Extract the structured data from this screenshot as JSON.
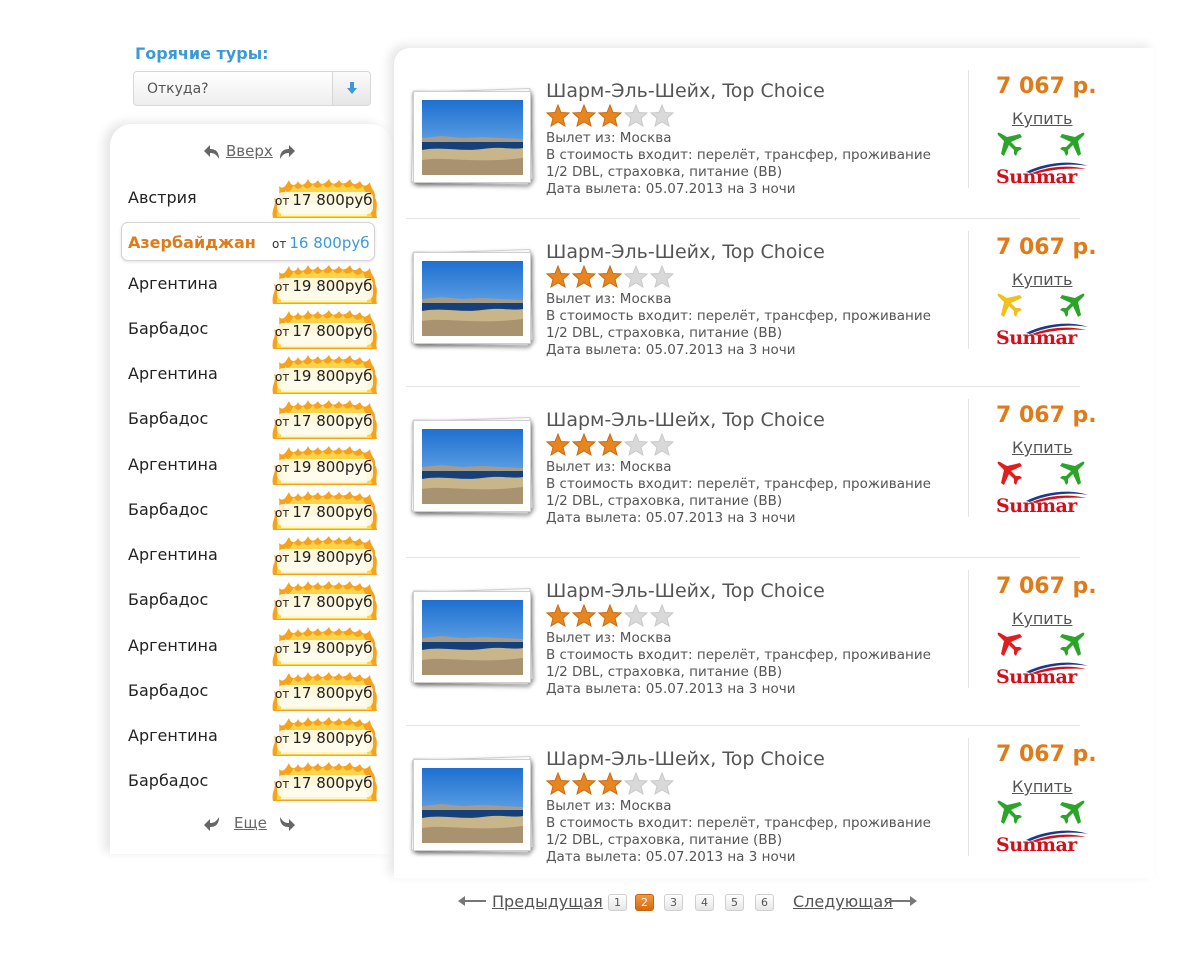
{
  "sidebar": {
    "title": "Горячие туры:",
    "from_placeholder": "Откуда?",
    "up_label": "Вверх",
    "more_label": "Еще",
    "price_prefix": "от",
    "selected": {
      "name": "Азербайджан",
      "price": "16 800руб"
    },
    "countries": [
      {
        "name": "Австрия",
        "price": "17 800руб"
      },
      {
        "name": "Аргентина",
        "price": "19 800руб"
      },
      {
        "name": "Барбадос",
        "price": "17 800руб"
      },
      {
        "name": "Аргентина",
        "price": "19 800руб"
      },
      {
        "name": "Барбадос",
        "price": "17 800руб"
      },
      {
        "name": "Аргентина",
        "price": "19 800руб"
      },
      {
        "name": "Барбадос",
        "price": "17 800руб"
      },
      {
        "name": "Аргентина",
        "price": "19 800руб"
      },
      {
        "name": "Барбадос",
        "price": "17 800руб"
      },
      {
        "name": "Аргентина",
        "price": "19 800руб"
      },
      {
        "name": "Барбадос",
        "price": "17 800руб"
      },
      {
        "name": "Аргентина",
        "price": "19 800руб"
      },
      {
        "name": "Барбадос",
        "price": "17 800руб"
      }
    ]
  },
  "tours": [
    {
      "title": "Шарм-Эль-Шейх, Top Choice",
      "stars": 3,
      "max_stars": 5,
      "departure": "Вылет из: Москва",
      "includes": "В стоимость входит: перелёт, трансфер, проживание  1/2 DBL, страховка, питание (BB)",
      "date": "Дата вылета: 05.07.2013 на 3 ночи",
      "price": "7 067 р.",
      "buy": "Купить",
      "plane_out_color": "#2aa52a",
      "plane_back_color": "#2aa52a",
      "operator": "Sunmar"
    },
    {
      "title": "Шарм-Эль-Шейх, Top Choice",
      "stars": 3,
      "max_stars": 5,
      "departure": "Вылет из: Москва",
      "includes": "В стоимость входит: перелёт, трансфер, проживание  1/2 DBL, страховка, питание (BB)",
      "date": "Дата вылета: 05.07.2013 на 3 ночи",
      "price": "7 067 р.",
      "buy": "Купить",
      "plane_out_color": "#f2c01a",
      "plane_back_color": "#2aa52a",
      "operator": "Sunmar"
    },
    {
      "title": "Шарм-Эль-Шейх, Top Choice",
      "stars": 3,
      "max_stars": 5,
      "departure": "Вылет из: Москва",
      "includes": "В стоимость входит: перелёт, трансфер, проживание  1/2 DBL, страховка, питание (BB)",
      "date": "Дата вылета: 05.07.2013 на 3 ночи",
      "price": "7 067 р.",
      "buy": "Купить",
      "plane_out_color": "#e21d1d",
      "plane_back_color": "#2aa52a",
      "operator": "Sunmar"
    },
    {
      "title": "Шарм-Эль-Шейх, Top Choice",
      "stars": 3,
      "max_stars": 5,
      "departure": "Вылет из: Москва",
      "includes": "В стоимость входит: перелёт, трансфер, проживание  1/2 DBL, страховка, питание (BB)",
      "date": "Дата вылета: 05.07.2013 на 3 ночи",
      "price": "7 067 р.",
      "buy": "Купить",
      "plane_out_color": "#e21d1d",
      "plane_back_color": "#2aa52a",
      "operator": "Sunmar"
    },
    {
      "title": "Шарм-Эль-Шейх, Top Choice",
      "stars": 3,
      "max_stars": 5,
      "departure": "Вылет из: Москва",
      "includes": "В стоимость входит: перелёт, трансфер, проживание  1/2 DBL, страховка, питание (BB)",
      "date": "Дата вылета: 05.07.2013 на 3 ночи",
      "price": "7 067 р.",
      "buy": "Купить",
      "plane_out_color": "#2aa52a",
      "plane_back_color": "#2aa52a",
      "operator": "Sunmar"
    }
  ],
  "pagination": {
    "prev_label": "Предыдущая",
    "next_label": "Следующая",
    "pages": [
      "1",
      "2",
      "3",
      "4",
      "5",
      "6"
    ],
    "current": "2"
  },
  "colors": {
    "accent_blue": "#3a9ad9",
    "accent_orange": "#e07b1a",
    "operator_red": "#d0101a"
  }
}
